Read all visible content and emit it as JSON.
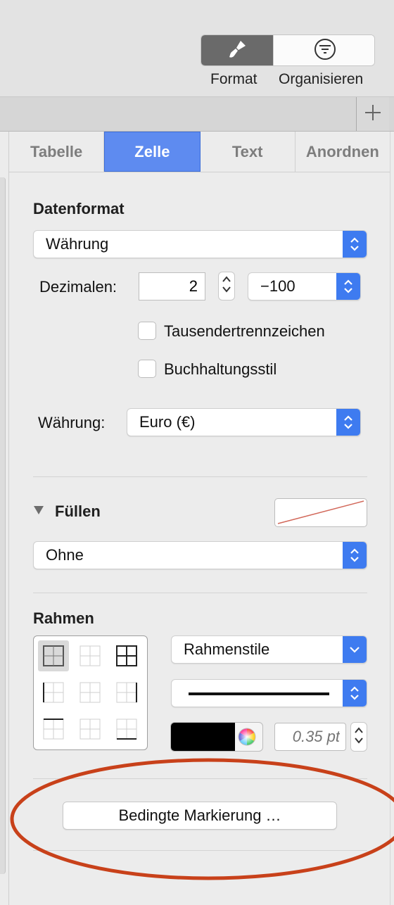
{
  "toolbar": {
    "format_label": "Format",
    "organize_label": "Organisieren",
    "format_icon": "paintbrush-icon",
    "organize_icon": "filter-icon"
  },
  "tabs": [
    {
      "label": "Tabelle",
      "active": false
    },
    {
      "label": "Zelle",
      "active": true
    },
    {
      "label": "Text",
      "active": false
    },
    {
      "label": "Anordnen",
      "active": false
    }
  ],
  "datenformat": {
    "title": "Datenformat",
    "format_value": "Währung",
    "decimals_label": "Dezimalen:",
    "decimals_value": "2",
    "negative_value": "−100",
    "thousands_label": "Tausendertrennzeichen",
    "accounting_label": "Buchhaltungsstil",
    "currency_label": "Währung:",
    "currency_value": "Euro (€)"
  },
  "fill": {
    "title": "Füllen",
    "value": "Ohne"
  },
  "border": {
    "title": "Rahmen",
    "style_value": "Rahmenstile",
    "color": "#000000",
    "width_placeholder": "0.35 pt"
  },
  "conditional": {
    "button_label": "Bedingte Markierung …"
  },
  "colors": {
    "accent": "#5e8bf0",
    "popup_arrow": "#3e7bf0",
    "annotation": "#c8411a"
  }
}
